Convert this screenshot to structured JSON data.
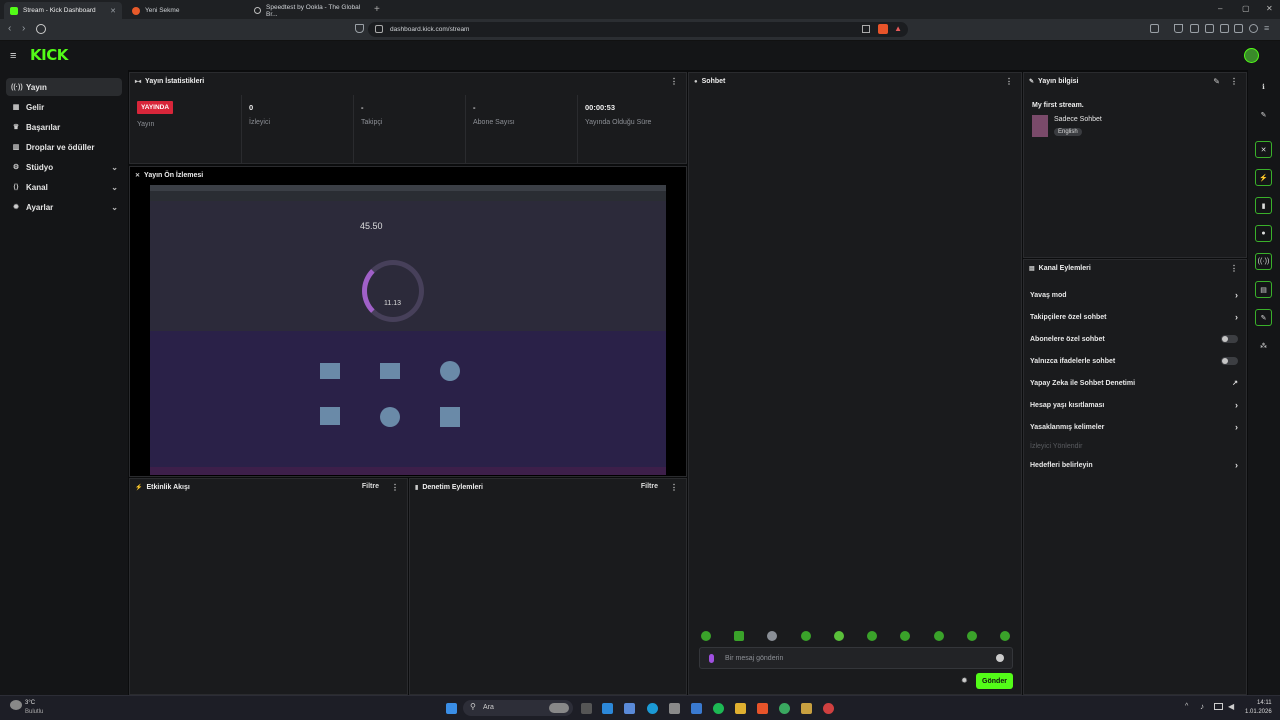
{
  "browser": {
    "tabs": [
      {
        "title": "Stream - Kick Dashboard",
        "active": true
      },
      {
        "title": "Yeni Sekme",
        "active": false
      },
      {
        "title": "Speedtest by Ookla - The Global Br...",
        "active": false
      }
    ],
    "url": "dashboard.kick.com/stream"
  },
  "app": {
    "logo": "KICK"
  },
  "sidebar": {
    "items": [
      {
        "label": "Yayın",
        "icon": "stream-icon"
      },
      {
        "label": "Gelir",
        "icon": "revenue-icon"
      },
      {
        "label": "Başarılar",
        "icon": "trophy-icon"
      },
      {
        "label": "Droplar ve ödüller",
        "icon": "gift-icon"
      },
      {
        "label": "Stüdyo",
        "icon": "studio-icon"
      },
      {
        "label": "Kanal",
        "icon": "channel-icon"
      },
      {
        "label": "Ayarlar",
        "icon": "gear-icon"
      }
    ]
  },
  "stats": {
    "title": "Yayın İstatistikleri",
    "live_badge": "YAYINDA",
    "items": [
      {
        "value": "",
        "label": "Yayın"
      },
      {
        "value": "0",
        "label": "İzleyici"
      },
      {
        "value": "-",
        "label": "Takipçi"
      },
      {
        "value": "-",
        "label": "Abone Sayısı"
      },
      {
        "value": "00:00:53",
        "label": "Yayında Olduğu Süre"
      }
    ]
  },
  "preview": {
    "title": "Yayın Ön İzlemesi",
    "speed": "45.50",
    "gauge": "11.13"
  },
  "activity": {
    "title": "Etkinlik Akışı",
    "filter": "Filtre"
  },
  "moderation": {
    "title": "Denetim Eylemleri",
    "filter": "Filtre"
  },
  "chat": {
    "title": "Sohbet",
    "placeholder": "Bir mesaj gönderin",
    "send": "Gönder"
  },
  "streaminfo": {
    "title": "Yayın bilgisi",
    "stream_title": "My first stream.",
    "category": "Sadece Sohbet",
    "language": "English"
  },
  "channel_actions": {
    "title": "Kanal Eylemleri",
    "items": [
      {
        "label": "Yavaş mod",
        "control": "arrow"
      },
      {
        "label": "Takipçilere özel sohbet",
        "control": "arrow"
      },
      {
        "label": "Abonelere özel sohbet",
        "control": "toggle"
      },
      {
        "label": "Yalnızca ifadelerle sohbet",
        "control": "toggle"
      },
      {
        "label": "Yapay Zeka ile Sohbet Denetimi",
        "control": "external"
      },
      {
        "label": "Hesap yaşı kısıtlaması",
        "control": "arrow"
      },
      {
        "label": "Yasaklanmış kelimeler",
        "control": "arrow"
      },
      {
        "label": "İzleyici Yönlendir",
        "control": "none",
        "disabled": true
      },
      {
        "label": "Hedefleri belirleyin",
        "control": "arrow"
      }
    ]
  },
  "taskbar": {
    "weather_temp": "3°C",
    "weather_desc": "Bulutlu",
    "search": "Ara",
    "time": "14:11",
    "date": "1.01.2026"
  },
  "colors": {
    "accent": "#53fc18",
    "live": "#d8263a"
  }
}
